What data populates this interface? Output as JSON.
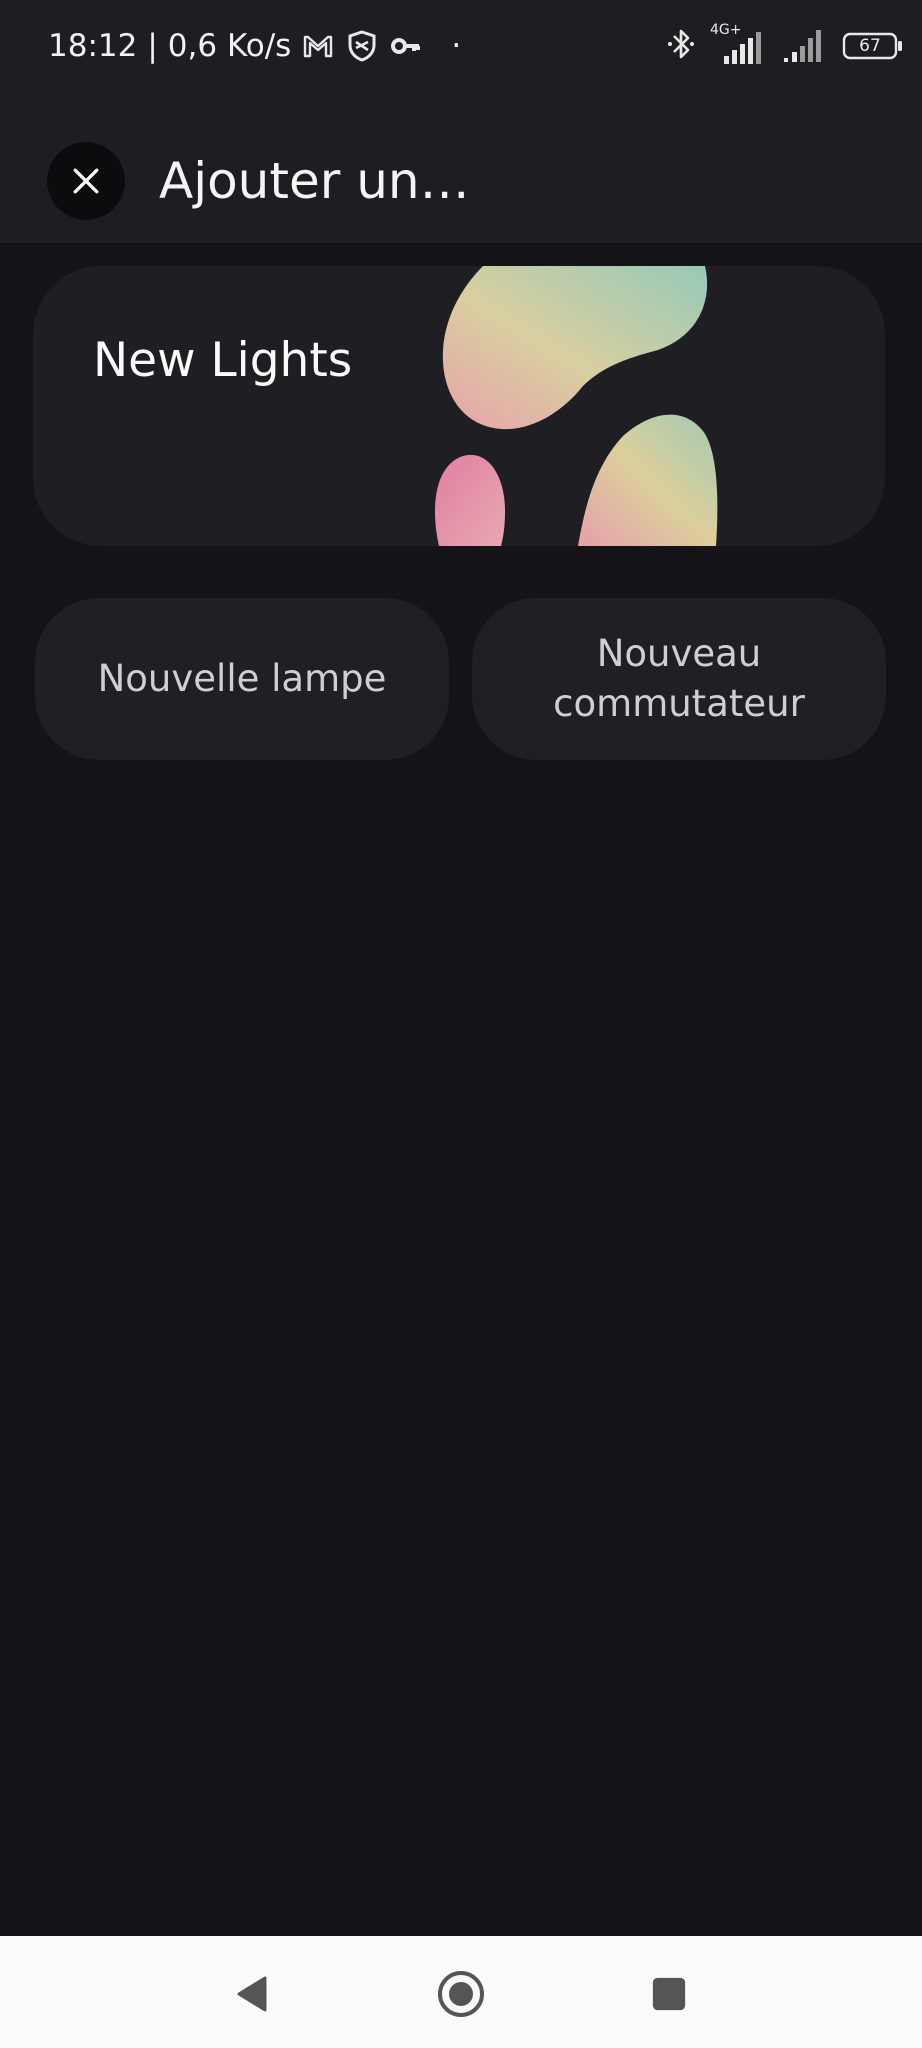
{
  "status_bar": {
    "time": "18:12",
    "separator": "|",
    "network_speed": "0,6 Ko/s",
    "dot": "·",
    "left_icons": [
      "gmail-icon",
      "shield-icon",
      "key-icon"
    ],
    "right_icons": [
      "bluetooth-icon",
      "signal-icon",
      "signal-icon",
      "battery-icon"
    ],
    "network_type": "4G+",
    "battery_level": "67"
  },
  "header": {
    "title": "Ajouter un…",
    "close_icon": "close-icon"
  },
  "hero_card": {
    "label": "New Lights"
  },
  "tiles": [
    {
      "label": "Nouvelle lampe"
    },
    {
      "label": "Nouveau\ncommutateur"
    }
  ],
  "nav_bar": {
    "icons": [
      "back-icon",
      "home-icon",
      "recents-icon"
    ]
  },
  "colors": {
    "background": "#141418",
    "header": "#1e1e22",
    "card": "#1f1f23",
    "nav_bar": "#fbfbfb"
  }
}
